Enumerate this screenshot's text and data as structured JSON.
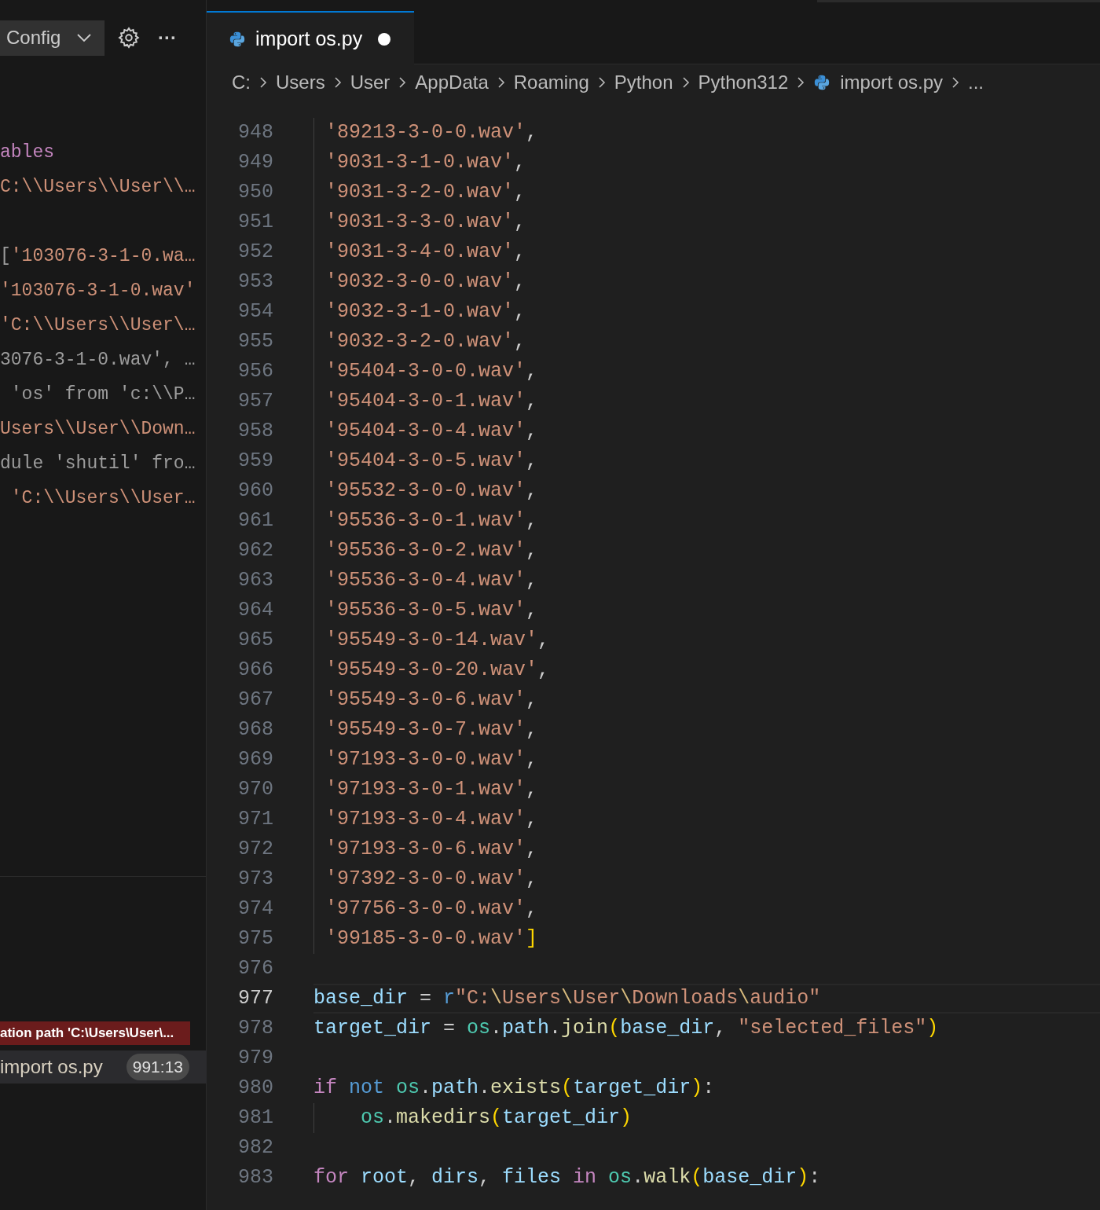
{
  "sidebar": {
    "config_button": "Config",
    "more": "···",
    "variables": [
      [
        [
          {
            "kind": "keyword",
            "text": "ables"
          }
        ],
        [
          {
            "kind": "string",
            "text": "C:\\\\Users\\\\User\\\\…"
          }
        ]
      ],
      [
        [
          {
            "kind": "plain",
            "text": "["
          },
          {
            "kind": "string",
            "text": "'103076-3-1-0.wa…"
          }
        ],
        [
          {
            "kind": "string",
            "text": "'103076-3-1-0.wav'"
          }
        ],
        [
          {
            "kind": "string",
            "text": "'C:\\\\Users\\\\User\\…"
          }
        ],
        [
          {
            "kind": "plain",
            "text": "3076-3-1-0.wav', …"
          }
        ],
        [
          {
            "kind": "plain",
            "text": " 'os' from 'c:\\\\P…"
          }
        ],
        [
          {
            "kind": "string",
            "text": "Users\\\\User\\\\Down…"
          }
        ],
        [
          {
            "kind": "plain",
            "text": "dule 'shutil' fro…"
          }
        ],
        [
          {
            "kind": "string",
            "text": " 'C:\\\\Users\\\\User…"
          }
        ]
      ]
    ],
    "error_banner": "ation path 'C:\\Users\\User\\...",
    "call_stack": {
      "file": "import os.py",
      "position": "991:13"
    }
  },
  "tabs": [
    {
      "label": "import os.py",
      "selected": true,
      "modified": true
    }
  ],
  "breadcrumb": [
    {
      "kind": "folder",
      "text": "C:"
    },
    {
      "kind": "folder",
      "text": "Users"
    },
    {
      "kind": "folder",
      "text": "User"
    },
    {
      "kind": "folder",
      "text": "AppData"
    },
    {
      "kind": "folder",
      "text": "Roaming"
    },
    {
      "kind": "folder",
      "text": "Python"
    },
    {
      "kind": "folder",
      "text": "Python312"
    },
    {
      "kind": "file",
      "text": "import os.py"
    },
    {
      "kind": "more",
      "text": "..."
    }
  ],
  "code": [
    {
      "number": "948",
      "current": false,
      "tokens": [
        {
          "kind": "string",
          "text": " '89213-3-0-0.wav'"
        },
        {
          "kind": "plain",
          "text": ","
        }
      ]
    },
    {
      "number": "949",
      "current": false,
      "tokens": [
        {
          "kind": "string",
          "text": " '9031-3-1-0.wav'"
        },
        {
          "kind": "plain",
          "text": ","
        }
      ]
    },
    {
      "number": "950",
      "current": false,
      "tokens": [
        {
          "kind": "string",
          "text": " '9031-3-2-0.wav'"
        },
        {
          "kind": "plain",
          "text": ","
        }
      ]
    },
    {
      "number": "951",
      "current": false,
      "tokens": [
        {
          "kind": "string",
          "text": " '9031-3-3-0.wav'"
        },
        {
          "kind": "plain",
          "text": ","
        }
      ]
    },
    {
      "number": "952",
      "current": false,
      "tokens": [
        {
          "kind": "string",
          "text": " '9031-3-4-0.wav'"
        },
        {
          "kind": "plain",
          "text": ","
        }
      ]
    },
    {
      "number": "953",
      "current": false,
      "tokens": [
        {
          "kind": "string",
          "text": " '9032-3-0-0.wav'"
        },
        {
          "kind": "plain",
          "text": ","
        }
      ]
    },
    {
      "number": "954",
      "current": false,
      "tokens": [
        {
          "kind": "string",
          "text": " '9032-3-1-0.wav'"
        },
        {
          "kind": "plain",
          "text": ","
        }
      ]
    },
    {
      "number": "955",
      "current": false,
      "tokens": [
        {
          "kind": "string",
          "text": " '9032-3-2-0.wav'"
        },
        {
          "kind": "plain",
          "text": ","
        }
      ]
    },
    {
      "number": "956",
      "current": false,
      "tokens": [
        {
          "kind": "string",
          "text": " '95404-3-0-0.wav'"
        },
        {
          "kind": "plain",
          "text": ","
        }
      ]
    },
    {
      "number": "957",
      "current": false,
      "tokens": [
        {
          "kind": "string",
          "text": " '95404-3-0-1.wav'"
        },
        {
          "kind": "plain",
          "text": ","
        }
      ]
    },
    {
      "number": "958",
      "current": false,
      "tokens": [
        {
          "kind": "string",
          "text": " '95404-3-0-4.wav'"
        },
        {
          "kind": "plain",
          "text": ","
        }
      ]
    },
    {
      "number": "959",
      "current": false,
      "tokens": [
        {
          "kind": "string",
          "text": " '95404-3-0-5.wav'"
        },
        {
          "kind": "plain",
          "text": ","
        }
      ]
    },
    {
      "number": "960",
      "current": false,
      "tokens": [
        {
          "kind": "string",
          "text": " '95532-3-0-0.wav'"
        },
        {
          "kind": "plain",
          "text": ","
        }
      ]
    },
    {
      "number": "961",
      "current": false,
      "tokens": [
        {
          "kind": "string",
          "text": " '95536-3-0-1.wav'"
        },
        {
          "kind": "plain",
          "text": ","
        }
      ]
    },
    {
      "number": "962",
      "current": false,
      "tokens": [
        {
          "kind": "string",
          "text": " '95536-3-0-2.wav'"
        },
        {
          "kind": "plain",
          "text": ","
        }
      ]
    },
    {
      "number": "963",
      "current": false,
      "tokens": [
        {
          "kind": "string",
          "text": " '95536-3-0-4.wav'"
        },
        {
          "kind": "plain",
          "text": ","
        }
      ]
    },
    {
      "number": "964",
      "current": false,
      "tokens": [
        {
          "kind": "string",
          "text": " '95536-3-0-5.wav'"
        },
        {
          "kind": "plain",
          "text": ","
        }
      ]
    },
    {
      "number": "965",
      "current": false,
      "tokens": [
        {
          "kind": "string",
          "text": " '95549-3-0-14.wav'"
        },
        {
          "kind": "plain",
          "text": ","
        }
      ]
    },
    {
      "number": "966",
      "current": false,
      "tokens": [
        {
          "kind": "string",
          "text": " '95549-3-0-20.wav'"
        },
        {
          "kind": "plain",
          "text": ","
        }
      ]
    },
    {
      "number": "967",
      "current": false,
      "tokens": [
        {
          "kind": "string",
          "text": " '95549-3-0-6.wav'"
        },
        {
          "kind": "plain",
          "text": ","
        }
      ]
    },
    {
      "number": "968",
      "current": false,
      "tokens": [
        {
          "kind": "string",
          "text": " '95549-3-0-7.wav'"
        },
        {
          "kind": "plain",
          "text": ","
        }
      ]
    },
    {
      "number": "969",
      "current": false,
      "tokens": [
        {
          "kind": "string",
          "text": " '97193-3-0-0.wav'"
        },
        {
          "kind": "plain",
          "text": ","
        }
      ]
    },
    {
      "number": "970",
      "current": false,
      "tokens": [
        {
          "kind": "string",
          "text": " '97193-3-0-1.wav'"
        },
        {
          "kind": "plain",
          "text": ","
        }
      ]
    },
    {
      "number": "971",
      "current": false,
      "tokens": [
        {
          "kind": "string",
          "text": " '97193-3-0-4.wav'"
        },
        {
          "kind": "plain",
          "text": ","
        }
      ]
    },
    {
      "number": "972",
      "current": false,
      "tokens": [
        {
          "kind": "string",
          "text": " '97193-3-0-6.wav'"
        },
        {
          "kind": "plain",
          "text": ","
        }
      ]
    },
    {
      "number": "973",
      "current": false,
      "tokens": [
        {
          "kind": "string",
          "text": " '97392-3-0-0.wav'"
        },
        {
          "kind": "plain",
          "text": ","
        }
      ]
    },
    {
      "number": "974",
      "current": false,
      "tokens": [
        {
          "kind": "string",
          "text": " '97756-3-0-0.wav'"
        },
        {
          "kind": "plain",
          "text": ","
        }
      ]
    },
    {
      "number": "975",
      "current": false,
      "tokens": [
        {
          "kind": "string",
          "text": " '99185-3-0-0.wav'"
        },
        {
          "kind": "bracket",
          "text": "]"
        }
      ]
    },
    {
      "number": "976",
      "current": false
    },
    {
      "number": "977",
      "current": true,
      "tokens": [
        {
          "kind": "variable",
          "text": "base_dir"
        },
        {
          "kind": "plain",
          "text": " = "
        },
        {
          "kind": "keyword",
          "text": "r"
        },
        {
          "kind": "string",
          "text": "\"C:"
        },
        {
          "kind": "escape",
          "text": "\\"
        },
        {
          "kind": "string",
          "text": "Users"
        },
        {
          "kind": "escape",
          "text": "\\"
        },
        {
          "kind": "string",
          "text": "User"
        },
        {
          "kind": "escape",
          "text": "\\"
        },
        {
          "kind": "string",
          "text": "Downloads"
        },
        {
          "kind": "escape",
          "text": "\\"
        },
        {
          "kind": "string",
          "text": "audio\""
        }
      ]
    },
    {
      "number": "978",
      "current": false,
      "tokens": [
        {
          "kind": "variable",
          "text": "target_dir"
        },
        {
          "kind": "plain",
          "text": " = "
        },
        {
          "kind": "module",
          "text": "os"
        },
        {
          "kind": "plain",
          "text": "."
        },
        {
          "kind": "variable",
          "text": "path"
        },
        {
          "kind": "plain",
          "text": "."
        },
        {
          "kind": "function",
          "text": "join"
        },
        {
          "kind": "bracket",
          "text": "("
        },
        {
          "kind": "variable",
          "text": "base_dir"
        },
        {
          "kind": "plain",
          "text": ", "
        },
        {
          "kind": "string",
          "text": "\"selected_files\""
        },
        {
          "kind": "bracket",
          "text": ")"
        }
      ]
    },
    {
      "number": "979",
      "current": false
    },
    {
      "number": "980",
      "current": false,
      "tokens": [
        {
          "kind": "control",
          "text": "if"
        },
        {
          "kind": "keyword",
          "text": " not"
        },
        {
          "kind": "module",
          "text": " os"
        },
        {
          "kind": "plain",
          "text": "."
        },
        {
          "kind": "variable",
          "text": "path"
        },
        {
          "kind": "plain",
          "text": "."
        },
        {
          "kind": "function",
          "text": "exists"
        },
        {
          "kind": "bracket",
          "text": "("
        },
        {
          "kind": "variable",
          "text": "target_dir"
        },
        {
          "kind": "bracket",
          "text": ")"
        },
        {
          "kind": "plain",
          "text": ":"
        }
      ]
    },
    {
      "number": "981",
      "current": false,
      "tokens": [
        {
          "kind": "module",
          "text": "    os"
        },
        {
          "kind": "plain",
          "text": "."
        },
        {
          "kind": "function",
          "text": "makedirs"
        },
        {
          "kind": "bracket",
          "text": "("
        },
        {
          "kind": "variable",
          "text": "target_dir"
        },
        {
          "kind": "bracket",
          "text": ")"
        }
      ]
    },
    {
      "number": "982",
      "current": false
    },
    {
      "number": "983",
      "current": false,
      "tokens": [
        {
          "kind": "control",
          "text": "for"
        },
        {
          "kind": "variable",
          "text": " root"
        },
        {
          "kind": "plain",
          "text": ", "
        },
        {
          "kind": "variable",
          "text": "dirs"
        },
        {
          "kind": "plain",
          "text": ", "
        },
        {
          "kind": "variable",
          "text": "files"
        },
        {
          "kind": "control",
          "text": " in"
        },
        {
          "kind": "module",
          "text": " os"
        },
        {
          "kind": "plain",
          "text": "."
        },
        {
          "kind": "function",
          "text": "walk"
        },
        {
          "kind": "bracket",
          "text": "("
        },
        {
          "kind": "variable",
          "text": "base_dir"
        },
        {
          "kind": "bracket",
          "text": ")"
        },
        {
          "kind": "plain",
          "text": ":"
        }
      ]
    }
  ]
}
